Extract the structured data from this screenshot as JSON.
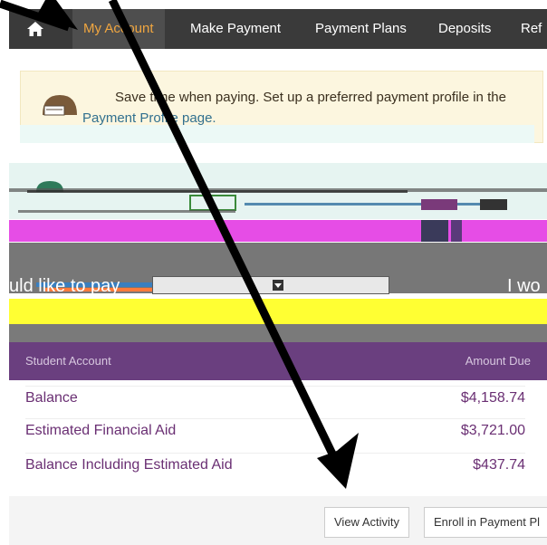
{
  "nav": {
    "items": [
      {
        "label": "My Account",
        "active": true
      },
      {
        "label": "Make Payment"
      },
      {
        "label": "Payment Plans"
      },
      {
        "label": "Deposits"
      },
      {
        "label": "Ref"
      }
    ]
  },
  "notice": {
    "text": "Save time when paying. Set up a preferred payment profile in the",
    "link": "Payment Profile page."
  },
  "payment": {
    "prompt": "uld like to pay",
    "right_text": "I wo"
  },
  "account": {
    "header_title": "Student Account",
    "header_amount": "Amount Due",
    "rows": [
      {
        "label": "Balance",
        "value": "$4,158.74"
      },
      {
        "label": "Estimated Financial Aid",
        "value": "$3,721.00"
      },
      {
        "label": "Balance Including Estimated Aid",
        "value": "$437.74"
      }
    ]
  },
  "footer": {
    "buttons": [
      {
        "label": "View Activity"
      },
      {
        "label": "Enroll in Payment Pl"
      }
    ]
  },
  "colors": {
    "nav_bg": "#3a3a3a",
    "nav_active": "#f0a640",
    "account_purple": "#6a2f73",
    "notice_bg": "#fcf6df"
  }
}
